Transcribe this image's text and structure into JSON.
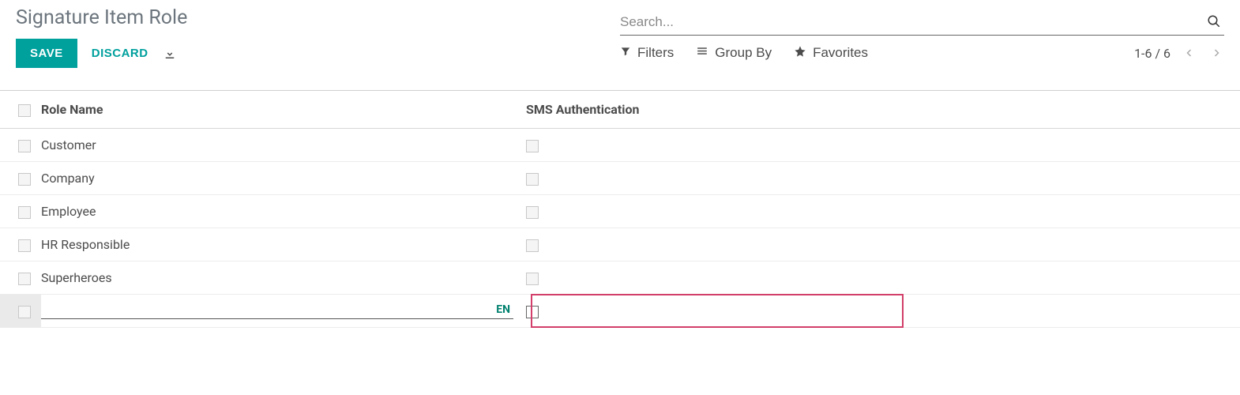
{
  "header": {
    "title": "Signature Item Role",
    "save_label": "SAVE",
    "discard_label": "DISCARD"
  },
  "search": {
    "placeholder": "Search...",
    "filters_label": "Filters",
    "groupby_label": "Group By",
    "favorites_label": "Favorites"
  },
  "pager": {
    "text": "1-6 / 6"
  },
  "table": {
    "col_name": "Role Name",
    "col_sms": "SMS Authentication",
    "rows": [
      {
        "name": "Customer",
        "sms": false
      },
      {
        "name": "Company",
        "sms": false
      },
      {
        "name": "Employee",
        "sms": false
      },
      {
        "name": "HR Responsible",
        "sms": false
      },
      {
        "name": "Superheroes",
        "sms": false
      }
    ],
    "edit_row": {
      "name": "",
      "lang": "EN",
      "sms": false
    }
  }
}
